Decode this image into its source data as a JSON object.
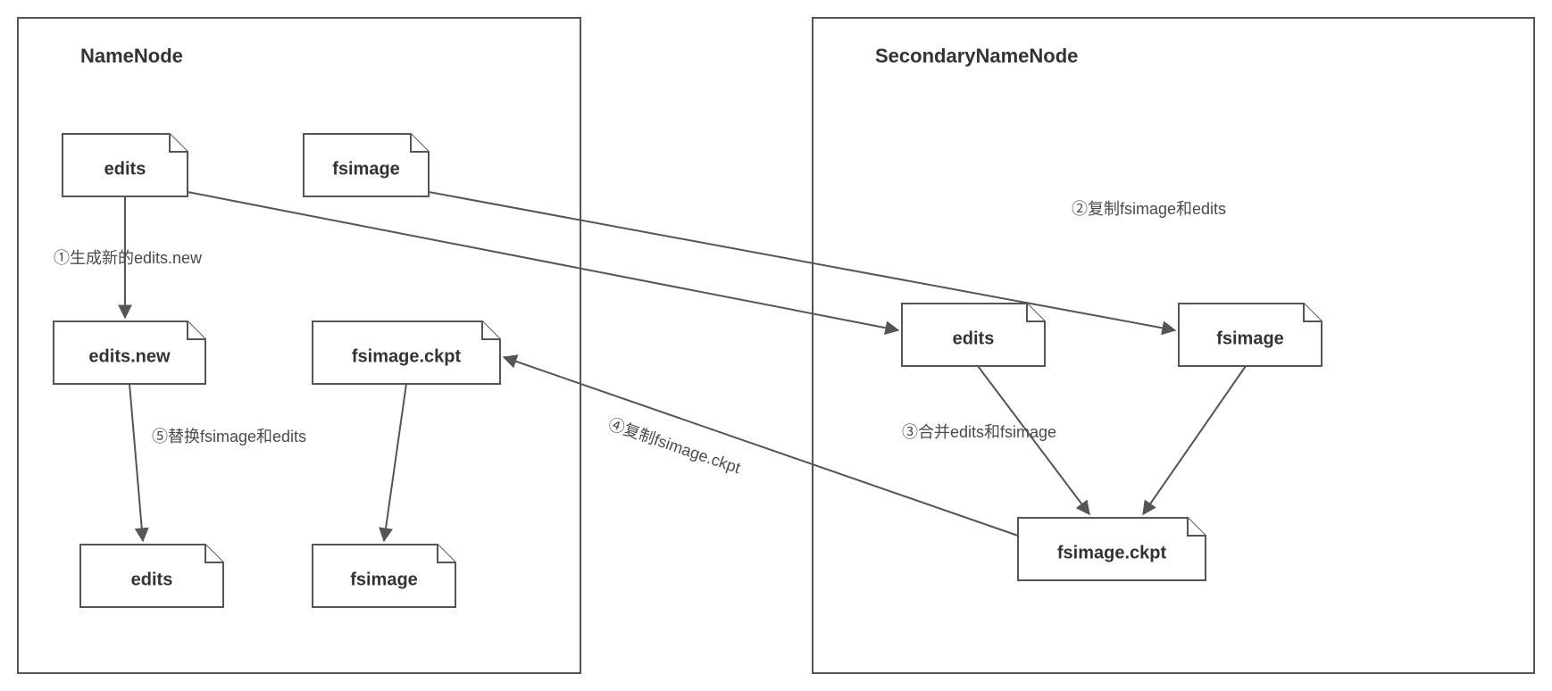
{
  "containers": {
    "namenode": {
      "title": "NameNode"
    },
    "secondary": {
      "title": "SecondaryNameNode"
    }
  },
  "files": {
    "nn_edits_top": "edits",
    "nn_fsimage_top": "fsimage",
    "nn_edits_new": "edits.new",
    "nn_fsimage_ckpt": "fsimage.ckpt",
    "nn_edits_bottom": "edits",
    "nn_fsimage_bottom": "fsimage",
    "snn_edits": "edits",
    "snn_fsimage": "fsimage",
    "snn_fsimage_ckpt": "fsimage.ckpt"
  },
  "steps": {
    "s1": "①生成新的edits.new",
    "s2": "②复制fsimage和edits",
    "s3": "③合并edits和fsimage",
    "s4": "④复制fsimage.ckpt",
    "s5": "⑤替换fsimage和edits"
  }
}
